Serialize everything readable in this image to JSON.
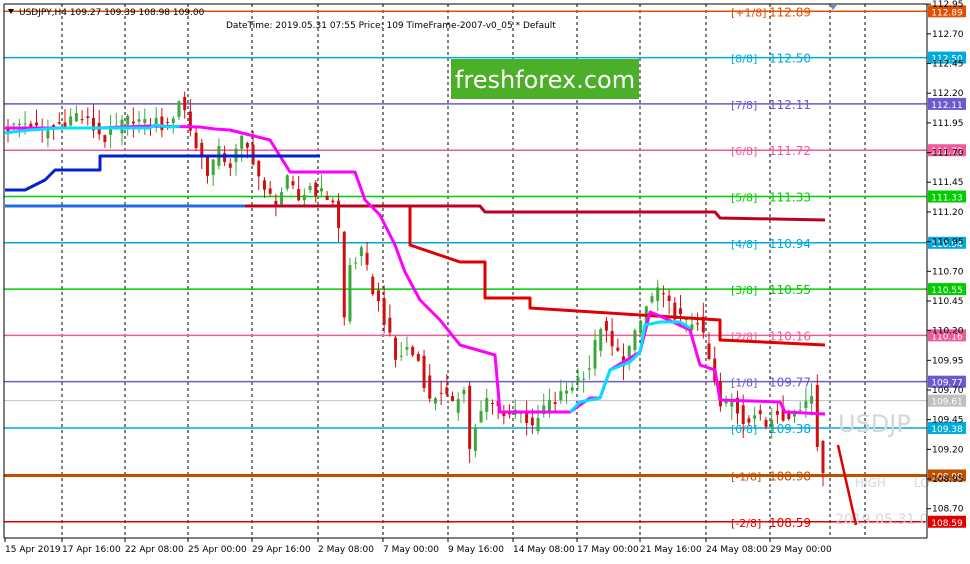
{
  "header": {
    "symbol_line": "USDJPY,H4  109.27 109.39 108.98 109.00",
    "info_line": "DateTime: 2019.05.31 07:55   Price: 109   TimeFrame-2007-v0_05   *   Default"
  },
  "watermark": {
    "brand": "freshforex.com",
    "symbol": "USDJP",
    "high_label": "HIGH",
    "low_label": "LO",
    "date_label": "2019.05.31 0"
  },
  "colors": {
    "background": "#ffffff",
    "frame": "#000000",
    "grid": "#000000",
    "up_candle": "#3aa83a",
    "down_candle": "#d01010",
    "brand_bg": "#4caf28",
    "red_line": "#e00000",
    "dark_red_line": "#c00020",
    "magenta_line": "#ff00ff",
    "cyan_line": "#00e0ff",
    "blue_line": "#0022cc",
    "watermark_text": "#d8d8d8"
  },
  "chart_data": {
    "type": "candlestick",
    "instrument": "USDJPY",
    "timeframe": "H4",
    "ylim": [
      108.47,
      112.96
    ],
    "x_range": [
      "2019-04-15",
      "2019-05-31"
    ],
    "time_ticks": [
      "15 Apr 2019",
      "17 Apr 16:00",
      "22 Apr 08:00",
      "25 Apr 00:00",
      "29 Apr 16:00",
      "2 May 08:00",
      "7 May 00:00",
      "9 May 16:00",
      "14 May 08:00",
      "17 May 00:00",
      "21 May 16:00",
      "24 May 08:00",
      "29 May 00:00"
    ],
    "price_ticks": [
      "112.95",
      "112.70",
      "112.45",
      "112.20",
      "111.95",
      "111.70",
      "111.45",
      "111.20",
      "110.95",
      "110.70",
      "110.45",
      "110.20",
      "109.95",
      "109.70",
      "109.45",
      "109.20",
      "108.95",
      "108.70"
    ],
    "last_ohlc": {
      "open": 109.27,
      "high": 109.39,
      "low": 108.98,
      "close": 109.0
    },
    "murrey_levels": [
      {
        "label": "[+1/8]",
        "value": 112.89,
        "color": "#e05000"
      },
      {
        "label": "[8/8]",
        "value": 112.5,
        "color": "#00aadd"
      },
      {
        "label": "[7/8]",
        "value": 112.11,
        "color": "#6a5acd"
      },
      {
        "label": "[6/8]",
        "value": 111.72,
        "color": "#ee5a9a"
      },
      {
        "label": "[5/8]",
        "value": 111.33,
        "color": "#00cc00"
      },
      {
        "label": "[4/8]",
        "value": 110.94,
        "color": "#00aadd"
      },
      {
        "label": "[3/8]",
        "value": 110.55,
        "color": "#00cc00"
      },
      {
        "label": "[2/8]",
        "value": 110.16,
        "color": "#ee5a9a"
      },
      {
        "label": "[1/8]",
        "value": 109.77,
        "color": "#6a5acd"
      },
      {
        "label": "[0/8]",
        "value": 109.38,
        "color": "#00aadd"
      },
      {
        "label": "[-1/8]",
        "value": 108.98,
        "color": "#c05000"
      },
      {
        "label": "[-2/8]",
        "value": 108.59,
        "color": "#e00000"
      }
    ],
    "current_price": 109.61,
    "close_series_anchors": [
      [
        0,
        111.9
      ],
      [
        3,
        111.95
      ],
      [
        6,
        111.86
      ],
      [
        9,
        111.94
      ],
      [
        12,
        112.02
      ],
      [
        14,
        111.95
      ],
      [
        17,
        111.82
      ],
      [
        19,
        111.9
      ],
      [
        22,
        112.0
      ],
      [
        24,
        111.93
      ],
      [
        26,
        111.96
      ],
      [
        28,
        111.9
      ],
      [
        30,
        112.15
      ],
      [
        31,
        112.05
      ],
      [
        33,
        111.75
      ],
      [
        35,
        111.55
      ],
      [
        37,
        111.7
      ],
      [
        39,
        111.6
      ],
      [
        41,
        111.8
      ],
      [
        43,
        111.65
      ],
      [
        45,
        111.35
      ],
      [
        47,
        111.3
      ],
      [
        49,
        111.45
      ],
      [
        51,
        111.3
      ],
      [
        53,
        111.42
      ],
      [
        55,
        111.35
      ],
      [
        57,
        111.3
      ],
      [
        58,
        111.05
      ],
      [
        59,
        110.3
      ],
      [
        60,
        110.75
      ],
      [
        62,
        110.85
      ],
      [
        64,
        110.55
      ],
      [
        66,
        110.3
      ],
      [
        68,
        109.95
      ],
      [
        70,
        110.05
      ],
      [
        72,
        109.95
      ],
      [
        74,
        109.6
      ],
      [
        76,
        109.7
      ],
      [
        78,
        109.55
      ],
      [
        80,
        109.75
      ],
      [
        81,
        109.2
      ],
      [
        82,
        109.4
      ],
      [
        84,
        109.6
      ],
      [
        86,
        109.55
      ],
      [
        88,
        109.5
      ],
      [
        90,
        109.55
      ],
      [
        92,
        109.35
      ],
      [
        94,
        109.55
      ],
      [
        96,
        109.6
      ],
      [
        98,
        109.7
      ],
      [
        100,
        109.8
      ],
      [
        102,
        109.9
      ],
      [
        104,
        110.25
      ],
      [
        106,
        110.05
      ],
      [
        108,
        109.95
      ],
      [
        110,
        110.15
      ],
      [
        112,
        110.4
      ],
      [
        114,
        110.55
      ],
      [
        115,
        110.45
      ],
      [
        117,
        110.35
      ],
      [
        119,
        110.25
      ],
      [
        121,
        110.3
      ],
      [
        123,
        109.95
      ],
      [
        125,
        109.55
      ],
      [
        127,
        109.6
      ],
      [
        129,
        109.45
      ],
      [
        131,
        109.5
      ],
      [
        133,
        109.4
      ],
      [
        135,
        109.55
      ],
      [
        137,
        109.45
      ],
      [
        139,
        109.55
      ],
      [
        141,
        109.7
      ],
      [
        142,
        109.27
      ],
      [
        143,
        109.0
      ]
    ],
    "indicator_lines": [
      {
        "name": "red_stairs",
        "points": [
          [
            245,
            206
          ],
          [
            410,
            206
          ],
          [
            410,
            245
          ],
          [
            460,
            262
          ],
          [
            485,
            262
          ],
          [
            485,
            298
          ],
          [
            530,
            298
          ],
          [
            530,
            308
          ],
          [
            720,
            320
          ],
          [
            720,
            340
          ],
          [
            825,
            345
          ]
        ]
      },
      {
        "name": "dark_red_flat",
        "points": [
          [
            245,
            206
          ],
          [
            480,
            206
          ],
          [
            485,
            212
          ],
          [
            715,
            212
          ],
          [
            720,
            218
          ],
          [
            825,
            220
          ]
        ]
      },
      {
        "name": "magenta",
        "points": [
          [
            5,
            128
          ],
          [
            100,
            128
          ],
          [
            150,
            126
          ],
          [
            200,
            127
          ],
          [
            215,
            129
          ],
          [
            230,
            130
          ],
          [
            250,
            135
          ],
          [
            270,
            140
          ],
          [
            290,
            172
          ],
          [
            355,
            172
          ],
          [
            365,
            200
          ],
          [
            380,
            215
          ],
          [
            395,
            245
          ],
          [
            405,
            272
          ],
          [
            420,
            300
          ],
          [
            440,
            320
          ],
          [
            460,
            345
          ],
          [
            495,
            355
          ],
          [
            500,
            412
          ],
          [
            570,
            412
          ],
          [
            590,
            398
          ],
          [
            600,
            398
          ],
          [
            610,
            370
          ],
          [
            640,
            352
          ],
          [
            650,
            312
          ],
          [
            660,
            316
          ],
          [
            690,
            330
          ],
          [
            700,
            365
          ],
          [
            715,
            370
          ],
          [
            720,
            400
          ],
          [
            780,
            402
          ],
          [
            785,
            412
          ],
          [
            825,
            414
          ]
        ]
      },
      {
        "name": "cyan",
        "points": [
          [
            5,
            133
          ],
          [
            30,
            130
          ],
          [
            60,
            128
          ],
          [
            120,
            128
          ],
          [
            150,
            128
          ],
          [
            155,
            125
          ],
          [
            170,
            127
          ],
          [
            180,
            126
          ]
        ]
      },
      {
        "name": "cyan_late",
        "points": [
          [
            570,
            412
          ],
          [
            580,
            402
          ],
          [
            600,
            398
          ],
          [
            610,
            370
          ],
          [
            630,
            362
          ],
          [
            640,
            352
          ],
          [
            645,
            325
          ],
          [
            660,
            322
          ],
          [
            680,
            322
          ],
          [
            690,
            328
          ]
        ]
      },
      {
        "name": "blue_stairs",
        "points": [
          [
            5,
            190
          ],
          [
            25,
            190
          ],
          [
            45,
            180
          ],
          [
            55,
            170
          ],
          [
            100,
            170
          ],
          [
            100,
            156
          ],
          [
            320,
            156
          ]
        ]
      },
      {
        "name": "blue_flat",
        "points": [
          [
            5,
            206
          ],
          [
            245,
            206
          ]
        ]
      },
      {
        "name": "red_projection",
        "points": [
          [
            838,
            445
          ],
          [
            856,
            525
          ]
        ]
      }
    ]
  }
}
